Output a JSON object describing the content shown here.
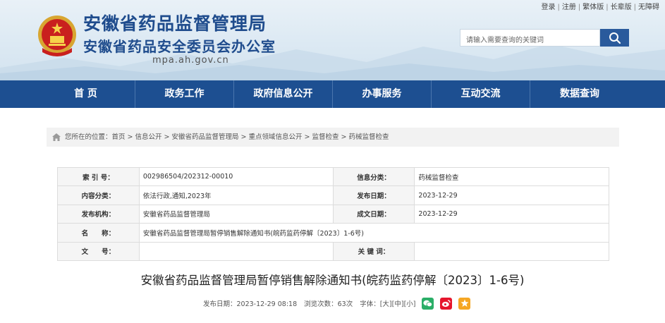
{
  "header": {
    "title_line1": "安徽省药品监督管理局",
    "title_line2": "安徽省药品安全委员会办公室",
    "domain": "mpa.ah.gov.cn",
    "toplinks": [
      "登录",
      "注册",
      "繁体版",
      "长辈版",
      "无障碍"
    ]
  },
  "search": {
    "placeholder": "请输入需要查询的关键词",
    "icon": "search-icon"
  },
  "nav": {
    "items": [
      "首 页",
      "政务工作",
      "政府信息公开",
      "办事服务",
      "互动交流",
      "数据查询"
    ]
  },
  "breadcrumb": {
    "prefix": "您所在的位置：",
    "items": [
      "首页",
      "信息公开",
      "安徽省药品监督管理局",
      "重点领域信息公开",
      "监督检查",
      "药械监督检查"
    ],
    "separator": ">"
  },
  "meta": {
    "index_label": "索 引 号：",
    "index_value": "002986504/202312-00010",
    "category_label": "信息分类：",
    "category_value": "药械监督检查",
    "content_label": "内容分类：",
    "content_value": "依法行政,通知,2023年",
    "pubdate_label": "发布日期：",
    "pubdate_value": "2023-12-29",
    "org_label": "发布机构：",
    "org_value": "安徽省药品监督管理局",
    "date_label": "成文日期：",
    "date_value": "2023-12-29",
    "name_label": "名　　称：",
    "name_value": "安徽省药品监督管理局暂停销售解除通知书(皖药监药停解〔2023〕1-6号)",
    "docno_label": "文　　号：",
    "docno_value": "",
    "keywords_label": "关 键 词：",
    "keywords_value": ""
  },
  "article": {
    "title": "安徽省药品监督管理局暂停销售解除通知书(皖药监药停解〔2023〕1-6号)",
    "pubtime": "发布日期：2023-12-29 08:18",
    "views": "浏览次数：63次",
    "fontsize_prefix": "字体：",
    "font_large": "[大]",
    "font_medium": "[中]",
    "font_small": "[小]"
  },
  "colors": {
    "brand": "#1d4f91",
    "title": "#1f4c8d",
    "wechat": "#2aae67",
    "weibo": "#e6162d",
    "qzone": "#f5a623"
  }
}
